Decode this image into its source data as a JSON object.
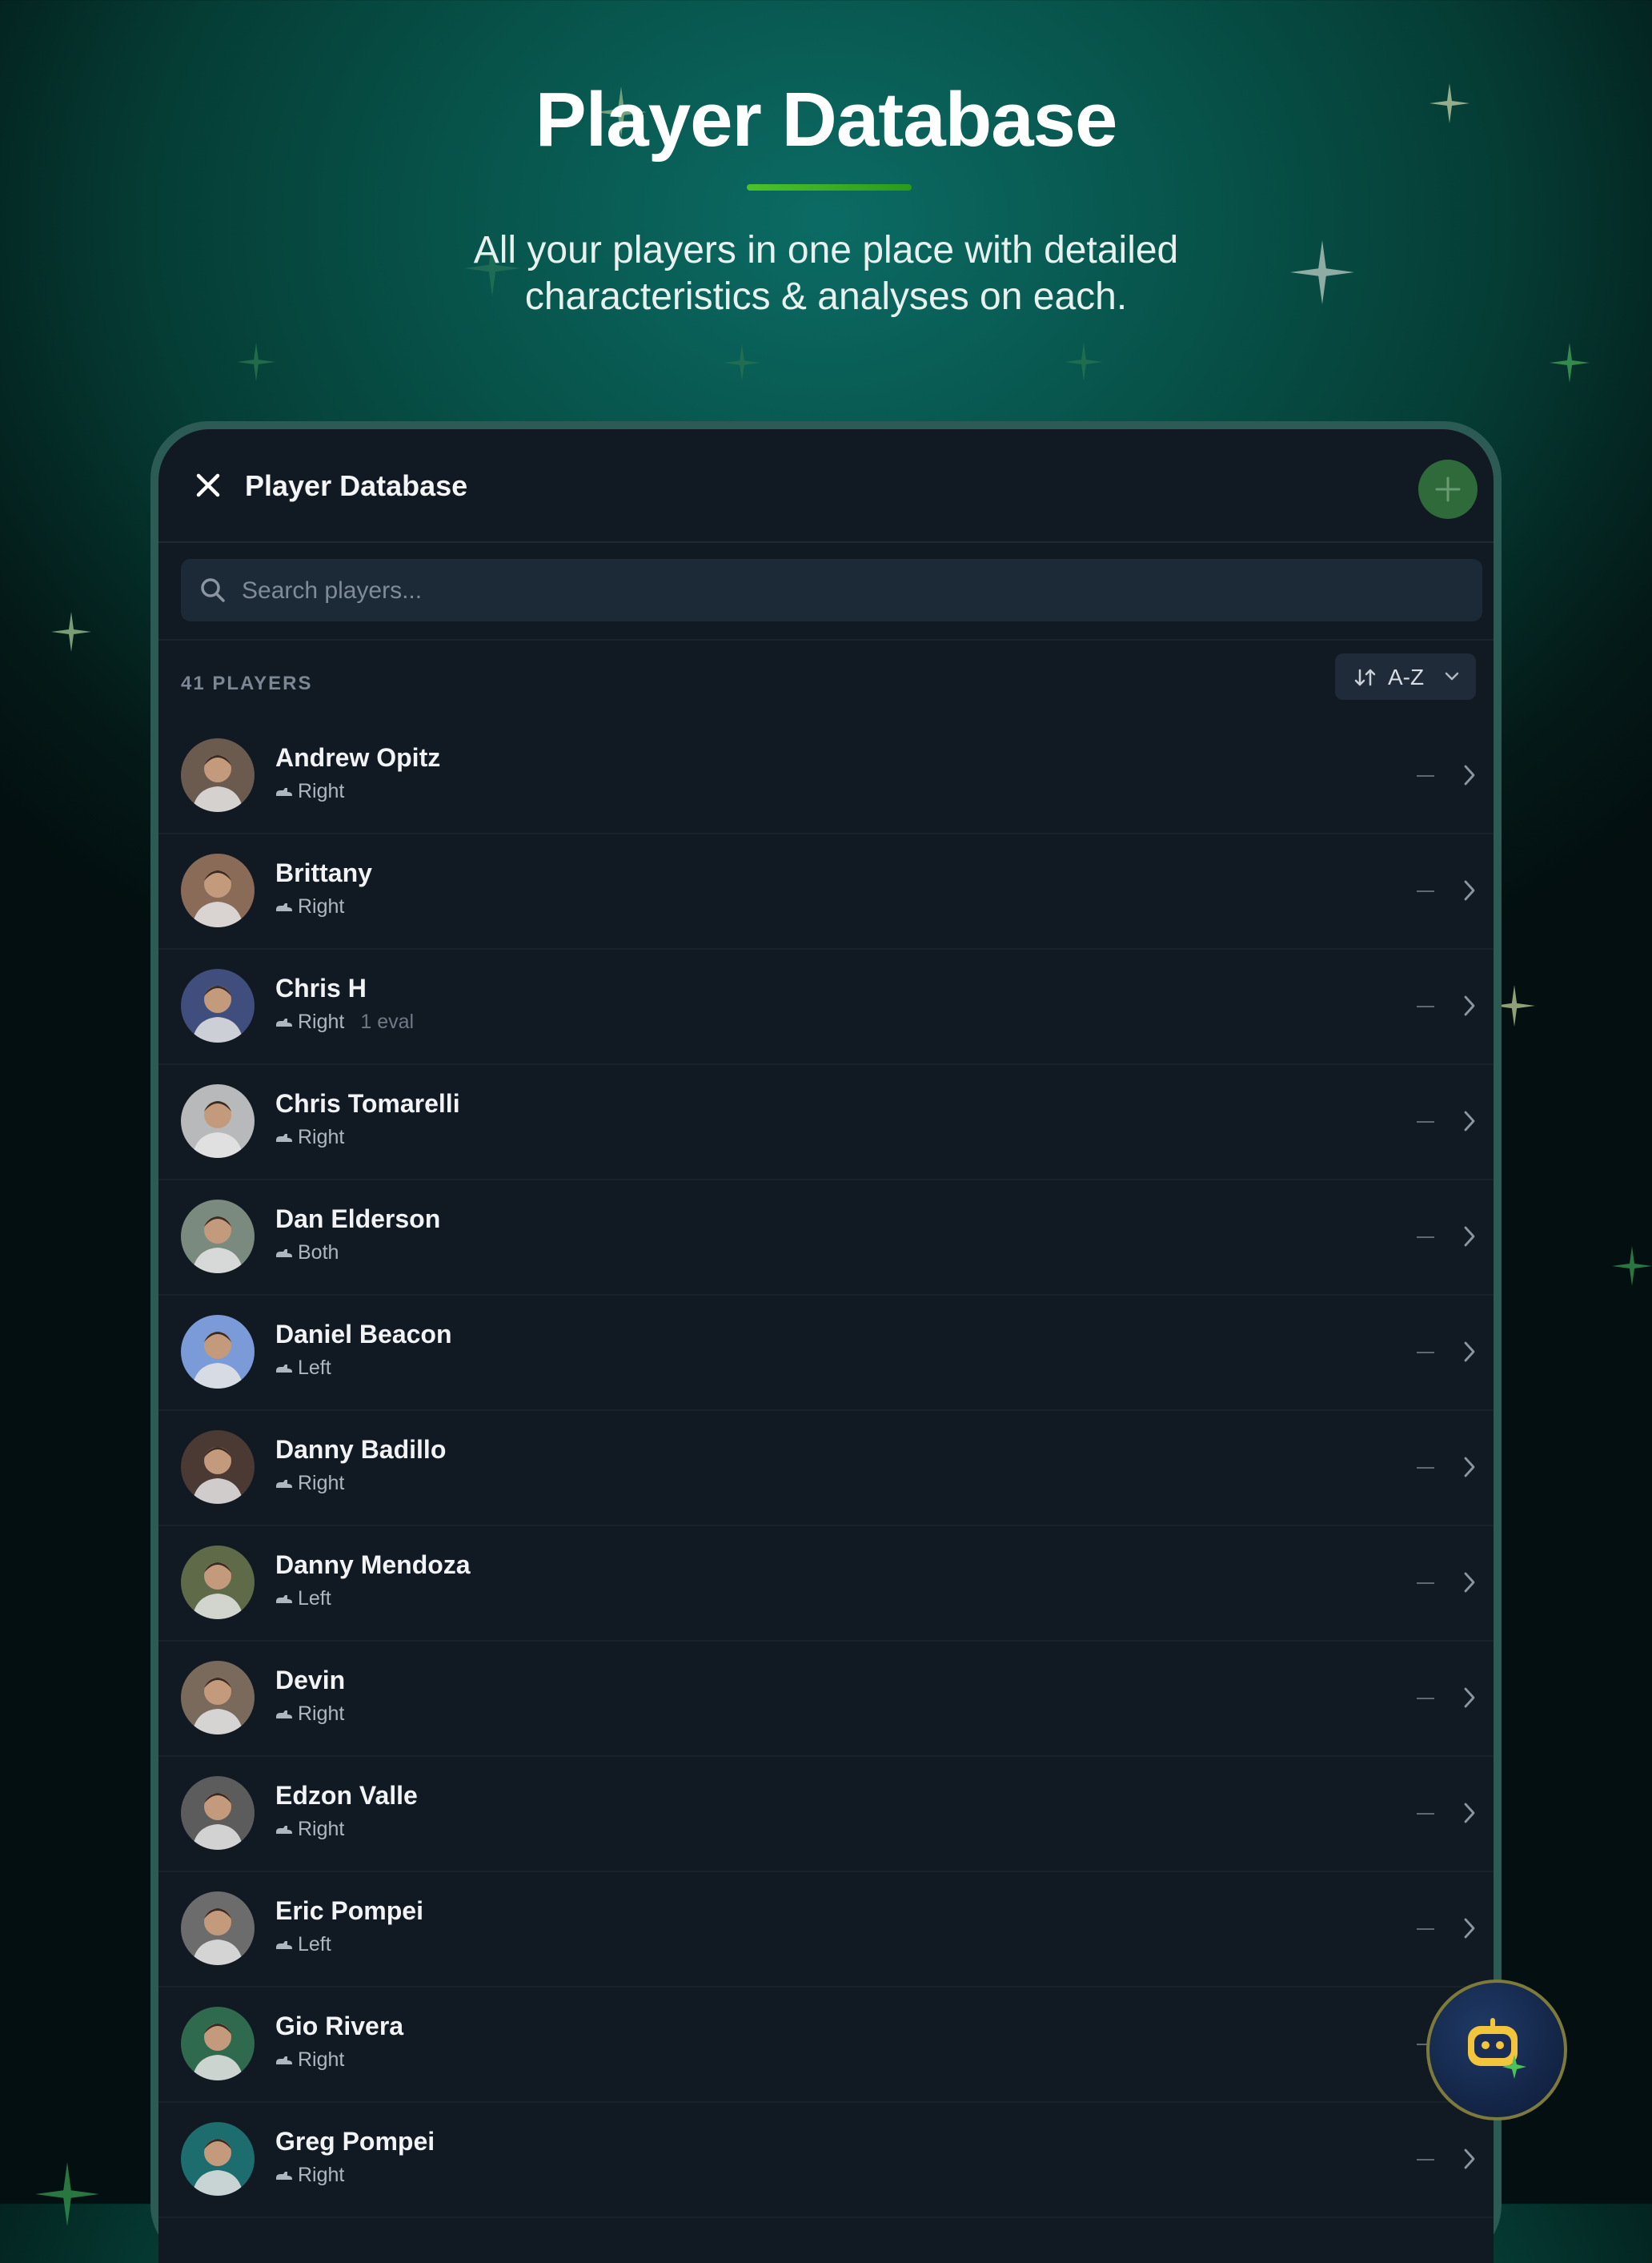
{
  "hero": {
    "title": "Player Database",
    "subtitle_line1": "All your players in one place with detailed",
    "subtitle_line2": "characteristics & analyses on each."
  },
  "app": {
    "title": "Player Database",
    "search_placeholder": "Search players...",
    "player_count": "41 PLAYERS",
    "sort_label": "A-Z"
  },
  "players": [
    {
      "name": "Andrew Opitz",
      "foot": "Right",
      "evals": "",
      "avatar_color": "#6b5a4e"
    },
    {
      "name": "Brittany",
      "foot": "Right",
      "evals": "",
      "avatar_color": "#8a6b57"
    },
    {
      "name": "Chris H",
      "foot": "Right",
      "evals": "1 eval",
      "avatar_color": "#3f4e7c"
    },
    {
      "name": "Chris Tomarelli",
      "foot": "Right",
      "evals": "",
      "avatar_color": "#b8b9ba"
    },
    {
      "name": "Dan Elderson",
      "foot": "Both",
      "evals": "",
      "avatar_color": "#7a8a7e"
    },
    {
      "name": "Daniel Beacon",
      "foot": "Left",
      "evals": "",
      "avatar_color": "#7a9ad8"
    },
    {
      "name": "Danny Badillo",
      "foot": "Right",
      "evals": "",
      "avatar_color": "#4a3a33"
    },
    {
      "name": "Danny Mendoza",
      "foot": "Left",
      "evals": "",
      "avatar_color": "#5f6a48"
    },
    {
      "name": "Devin",
      "foot": "Right",
      "evals": "",
      "avatar_color": "#7a6a5c"
    },
    {
      "name": "Edzon Valle",
      "foot": "Right",
      "evals": "",
      "avatar_color": "#5c5c5c"
    },
    {
      "name": "Eric Pompei",
      "foot": "Left",
      "evals": "",
      "avatar_color": "#6c6c6c"
    },
    {
      "name": "Gio Rivera",
      "foot": "Right",
      "evals": "",
      "avatar_color": "#2f6a4e"
    },
    {
      "name": "Greg Pompei",
      "foot": "Right",
      "evals": "",
      "avatar_color": "#1e6d6e"
    }
  ],
  "colors": {
    "accent_green": "#4cc22a",
    "screen_bg": "#111922",
    "add_button_bg": "#2f6a3a"
  },
  "icons": {
    "close": "close-icon",
    "add": "plus-icon",
    "search": "search-icon",
    "sort": "sort-icon",
    "chevron": "chevron-right-icon",
    "foot": "cleat-icon",
    "assistant": "robot-assistant-icon"
  }
}
